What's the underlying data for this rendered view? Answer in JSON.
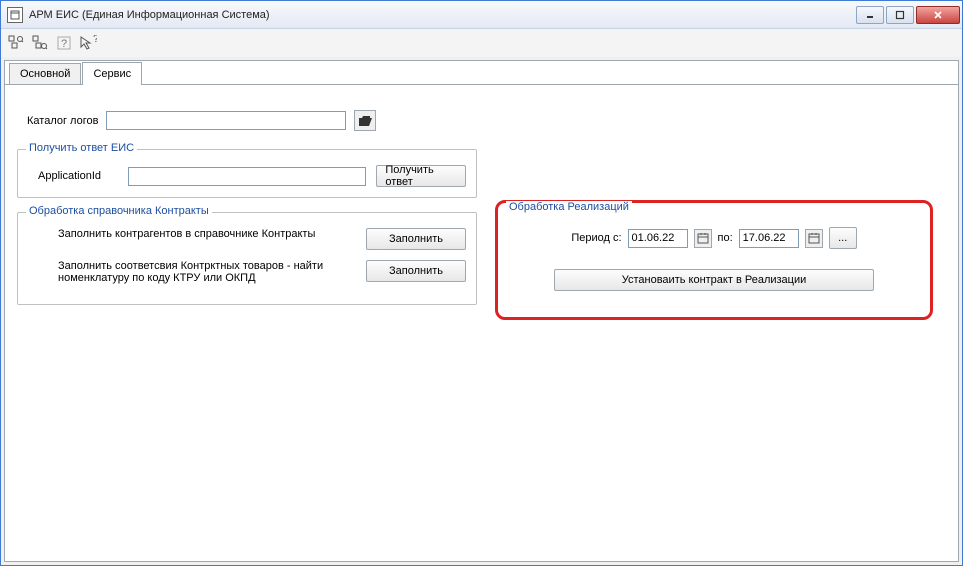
{
  "window": {
    "title": "АРМ ЕИС (Единая Информационная Система)"
  },
  "tabs": {
    "main": "Основной",
    "service": "Сервис"
  },
  "logs": {
    "label": "Каталог логов",
    "value": ""
  },
  "eis": {
    "legend": "Получить ответ ЕИС",
    "app_id_label": "ApplicationId",
    "app_id_value": "",
    "get_button": "Получить ответ"
  },
  "contracts": {
    "legend": "Обработка справочника Контракты",
    "row1_text": "Заполнить контрагентов в справочнике Контракты",
    "row1_btn": "Заполнить",
    "row2_text": "Заполнить соответсвия Контрктных товаров - найти номенклатуру по коду КТРУ или ОКПД",
    "row2_btn": "Заполнить"
  },
  "realizations": {
    "legend": "Обработка Реализаций",
    "period_from_label": "Период с:",
    "period_from_value": "01.06.22",
    "period_to_label": "по:",
    "period_to_value": "17.06.22",
    "ellipsis": "...",
    "set_contract_btn": "Установаить контракт в Реализации"
  }
}
